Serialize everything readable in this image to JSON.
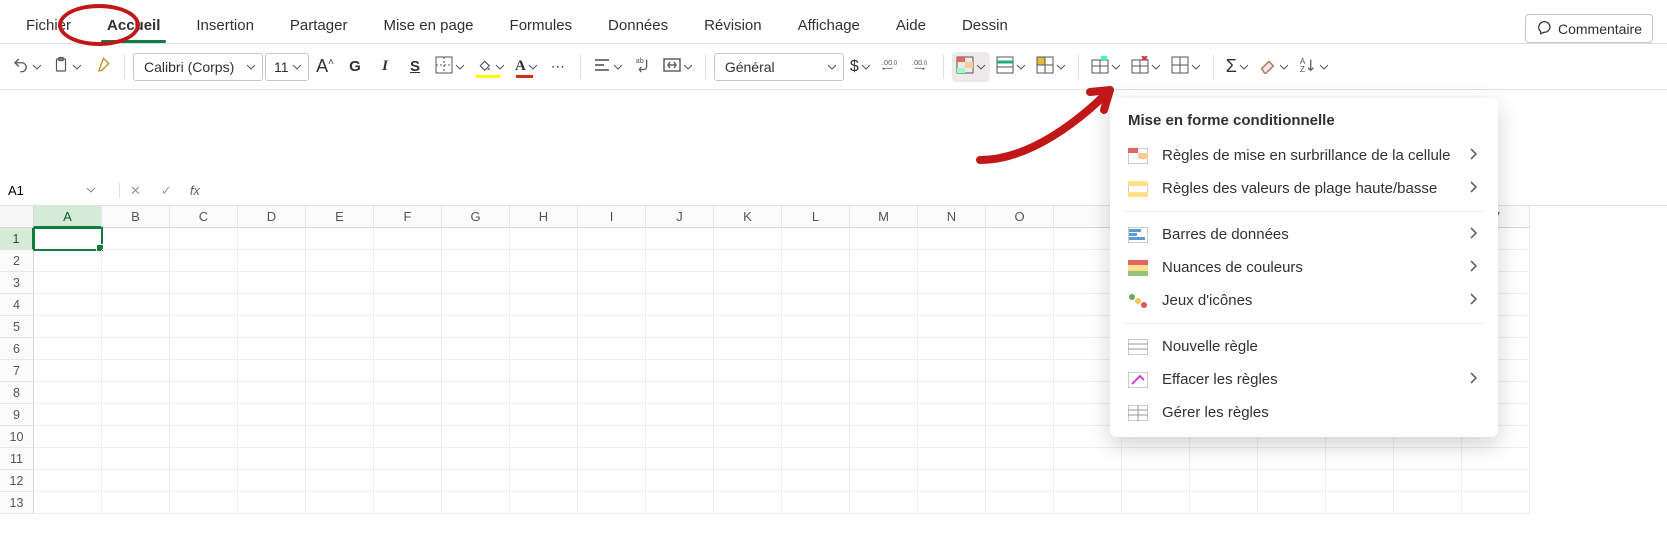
{
  "tabs": {
    "items": [
      "Fichier",
      "Accueil",
      "Insertion",
      "Partager",
      "Mise en page",
      "Formules",
      "Données",
      "Révision",
      "Affichage",
      "Aide",
      "Dessin"
    ],
    "active_index": 1
  },
  "comment_button": {
    "label": "Commentaire"
  },
  "toolbar": {
    "font_name": "Calibri (Corps)",
    "font_size": "11",
    "number_format": "Général"
  },
  "name_box": {
    "value": "A1"
  },
  "formula_bar": {
    "fx_label": "fx",
    "value": ""
  },
  "columns": [
    "A",
    "B",
    "C",
    "D",
    "E",
    "F",
    "G",
    "H",
    "I",
    "J",
    "K",
    "L",
    "M",
    "N",
    "O",
    "",
    "",
    "",
    "",
    "",
    "",
    "V"
  ],
  "rows": [
    "1",
    "2",
    "3",
    "4",
    "5",
    "6",
    "7",
    "8",
    "9",
    "10",
    "11",
    "12",
    "13"
  ],
  "selected_cell": {
    "row": 0,
    "col": 0
  },
  "cf_menu": {
    "title": "Mise en forme conditionnelle",
    "group1": [
      "Règles de mise en surbrillance de la cellule",
      "Règles des valeurs de plage haute/basse"
    ],
    "group2": [
      "Barres de données",
      "Nuances de couleurs",
      "Jeux d'icônes"
    ],
    "group3": [
      "Nouvelle règle",
      "Effacer les règles",
      "Gérer les règles"
    ],
    "arrows_g1": [
      true,
      true
    ],
    "arrows_g2": [
      true,
      true,
      true
    ],
    "arrows_g3": [
      false,
      true,
      false
    ]
  }
}
